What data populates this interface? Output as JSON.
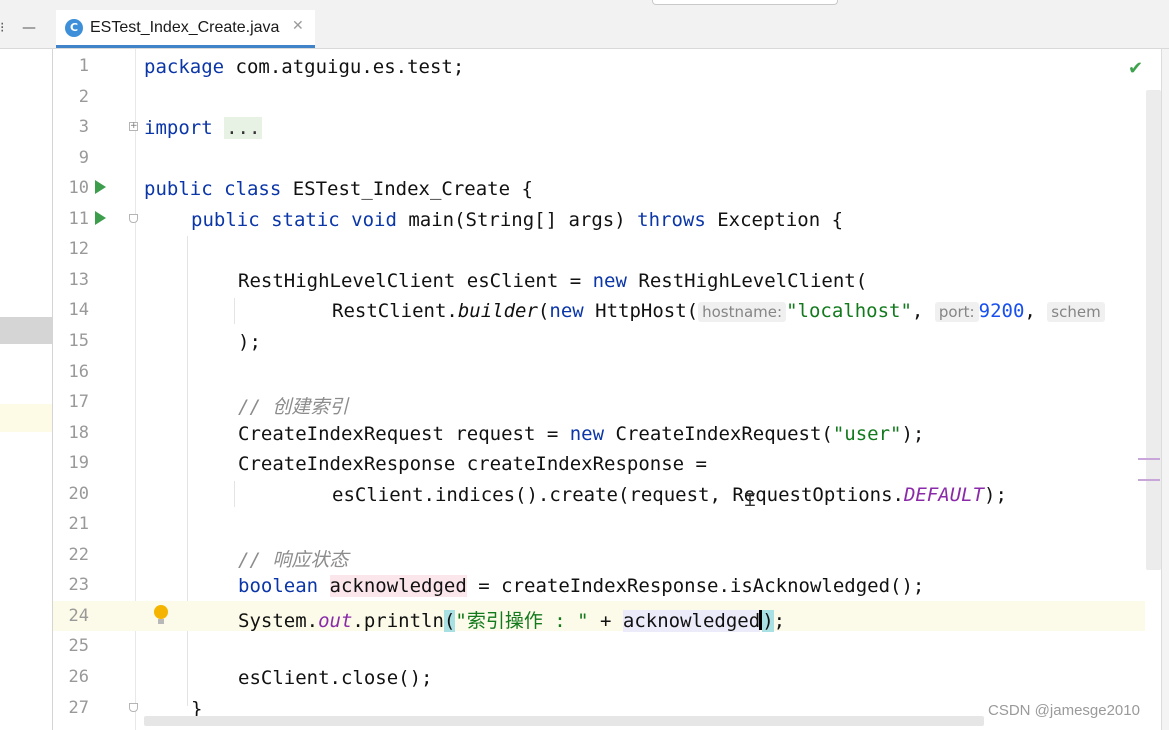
{
  "tab": {
    "icon_letter": "C",
    "filename": "ESTest_Index_Create.java",
    "close": "✕"
  },
  "window_controls": {
    "left_glyph": "⁝",
    "minimize_glyph": "—"
  },
  "status": {
    "check_glyph": "✔"
  },
  "watermark": "CSDN @jamesge2010",
  "lines": [
    {
      "n": "1"
    },
    {
      "n": "2"
    },
    {
      "n": "3"
    },
    {
      "n": "9"
    },
    {
      "n": "10"
    },
    {
      "n": "11"
    },
    {
      "n": "12"
    },
    {
      "n": "13"
    },
    {
      "n": "14"
    },
    {
      "n": "15"
    },
    {
      "n": "16"
    },
    {
      "n": "17"
    },
    {
      "n": "18"
    },
    {
      "n": "19"
    },
    {
      "n": "20"
    },
    {
      "n": "21"
    },
    {
      "n": "22"
    },
    {
      "n": "23"
    },
    {
      "n": "24"
    },
    {
      "n": "25"
    },
    {
      "n": "26"
    },
    {
      "n": "27"
    }
  ],
  "code": {
    "l1_kw": "package",
    "l1_rest": " com.atguigu.es.test;",
    "l3_kw": "import",
    "l3_dots": "...",
    "l10_kw": "public class",
    "l10_rest": " ESTest_Index_Create {",
    "l11_kw1": "public static void",
    "l11_name": " main(String[] args) ",
    "l11_kw2": "throws",
    "l11_rest": " Exception {",
    "l13_a": "RestHighLevelClient esClient = ",
    "l13_kw": "new",
    "l13_b": " RestHighLevelClient(",
    "l14_a": "RestClient.",
    "l14_builder": "builder",
    "l14_b": "(",
    "l14_kw": "new",
    "l14_c": " HttpHost(",
    "l14_hint1": "hostname:",
    "l14_str": "\"localhost\"",
    "l14_comma1": ", ",
    "l14_hint2": "port:",
    "l14_num": "9200",
    "l14_comma2": ", ",
    "l14_hint3": "schem",
    "l15": ");",
    "l17_cmt": "// 创建索引",
    "l18_a": "CreateIndexRequest request = ",
    "l18_kw": "new",
    "l18_b": " CreateIndexRequest(",
    "l18_str": "\"user\"",
    "l18_c": ");",
    "l19": "CreateIndexResponse createIndexResponse =",
    "l20_a": "esClient.indices().create(request, RequestOptions.",
    "l20_const": "DEFAULT",
    "l20_b": ");",
    "l22_cmt": "// 响应状态",
    "l23_kw": "boolean",
    "l23_sp": " ",
    "l23_var": "acknowledged",
    "l23_rest": " = createIndexResponse.isAcknowledged();",
    "l24_a": "System.",
    "l24_out": "out",
    "l24_b": ".println",
    "l24_paren": "(",
    "l24_str": "\"索引操作 : \"",
    "l24_plus": " + ",
    "l24_var": "acknowledged",
    "l24_close": ")",
    "l24_semi": ";",
    "l26": "esClient.close();",
    "l27": "}"
  }
}
